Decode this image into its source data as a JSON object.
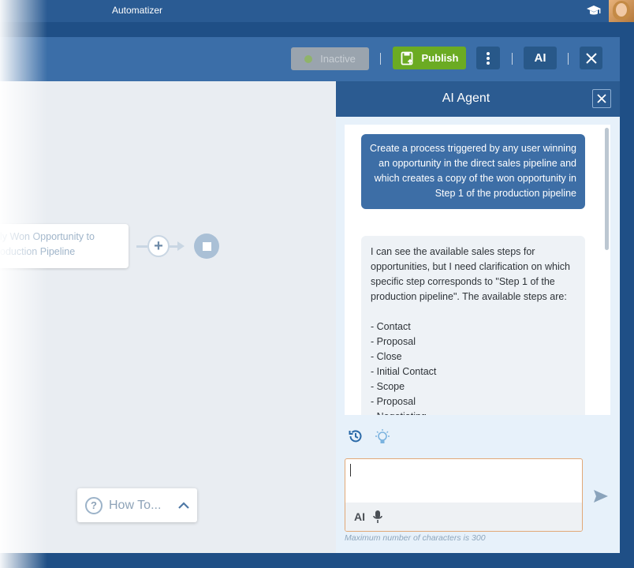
{
  "app": {
    "title": "Automatizer"
  },
  "toolbar": {
    "inactive_label": "Inactive",
    "publish_label": "Publish",
    "ai_label": "AI"
  },
  "canvas": {
    "node_line1": "ly Won Opportunity to",
    "node_line2": "oduction Pipeline",
    "plus": "+",
    "howto_label": "How To...",
    "howto_q": "?"
  },
  "ai_panel": {
    "title": "AI Agent",
    "user_message": "Create a process triggered by any user winning an opportunity in the direct sales pipeline and which creates a copy of the won opportunity in Step 1 of the production pipeline",
    "agent_message": "I can see the available sales steps for opportunities, but I need clarification on which specific step corresponds to \"Step 1 of the production pipeline\". The available steps are:\n\n- Contact\n- Proposal\n- Close\n- Initial Contact\n- Scope\n- Proposal\n- Negotiating",
    "input_value": "",
    "ai_small_label": "AI",
    "char_limit": "Maximum number of characters is 300"
  },
  "colors": {
    "publish": "#6bab23",
    "header": "#2b5b91",
    "input_border": "#e2a877"
  }
}
